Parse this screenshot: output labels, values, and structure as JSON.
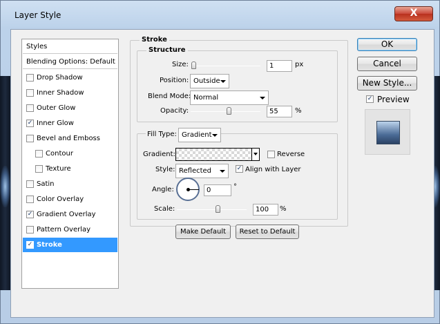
{
  "window": {
    "title": "Layer Style",
    "close_glyph": "X"
  },
  "styles_list": {
    "header": "Styles",
    "blending": "Blending Options: Default",
    "items": [
      {
        "label": "Drop Shadow",
        "checked": false
      },
      {
        "label": "Inner Shadow",
        "checked": false
      },
      {
        "label": "Outer Glow",
        "checked": false
      },
      {
        "label": "Inner Glow",
        "checked": true
      },
      {
        "label": "Bevel and Emboss",
        "checked": false
      },
      {
        "label": "Contour",
        "checked": false
      },
      {
        "label": "Texture",
        "checked": false
      },
      {
        "label": "Satin",
        "checked": false
      },
      {
        "label": "Color Overlay",
        "checked": false
      },
      {
        "label": "Gradient Overlay",
        "checked": true
      },
      {
        "label": "Pattern Overlay",
        "checked": false
      },
      {
        "label": "Stroke",
        "checked": true,
        "selected": true
      }
    ],
    "check_glyph": "✓"
  },
  "stroke": {
    "section_title": "Stroke",
    "structure_title": "Structure",
    "size_label": "Size:",
    "size_value": "1",
    "size_unit": "px",
    "size_slider_level": 0.01,
    "position_label": "Position:",
    "position_value": "Outside",
    "blend_mode_label": "Blend Mode:",
    "blend_mode_value": "Normal",
    "opacity_label": "Opacity:",
    "opacity_value": "55",
    "opacity_unit": "%",
    "opacity_slider_level": 0.55,
    "fill_type_label": "Fill Type:",
    "fill_type_value": "Gradient",
    "gradient_label": "Gradient:",
    "reverse_label": "Reverse",
    "reverse_checked": false,
    "style_label": "Style:",
    "style_value": "Reflected",
    "align_label": "Align with Layer",
    "align_checked": true,
    "angle_label": "Angle:",
    "angle_value": "0",
    "angle_unit": "°",
    "scale_label": "Scale:",
    "scale_value": "100",
    "scale_unit": "%",
    "scale_slider_level": 0.6,
    "make_default": "Make Default",
    "reset_default": "Reset to Default"
  },
  "buttons": {
    "ok": "OK",
    "cancel": "Cancel",
    "new_style": "New Style..."
  },
  "preview": {
    "label": "Preview",
    "checked": true
  }
}
